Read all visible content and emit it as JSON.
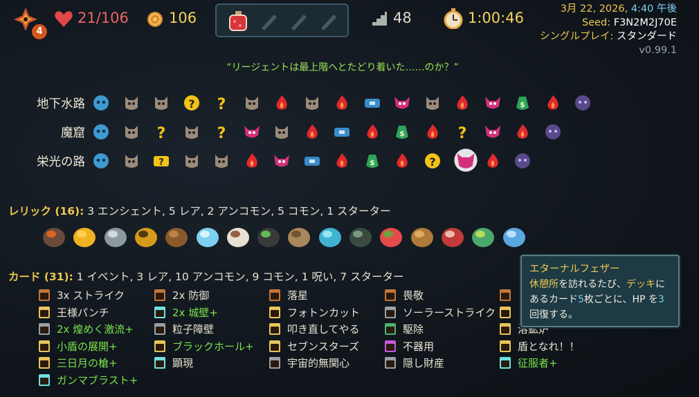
{
  "top_bar": {
    "floor_badge": "4",
    "hp": "21/106",
    "gold": "106",
    "floor": "48",
    "timer": "1:00:46",
    "potions": [
      "red-potion",
      "empty-slot",
      "empty-slot",
      "empty-slot"
    ]
  },
  "info": {
    "date": "3月 22, 2026, ",
    "time": "4:40 午後",
    "seed_label": "Seed: ",
    "seed": "F3N2M2J70E",
    "mode_label": "シングルプレイ: ",
    "mode": "スタンダード",
    "version": "v0.99.1"
  },
  "quote": "“リージェントは最上階へとたどり着いた……のか？”",
  "acts": [
    {
      "label": "地下水路",
      "nodes": [
        "ancient",
        "monster",
        "monster",
        "unknown-gold",
        "unknown",
        "monster",
        "rest",
        "monster",
        "rest",
        "treasure",
        "elite",
        "monster",
        "rest",
        "elite",
        "merchant",
        "rest",
        "boss"
      ]
    },
    {
      "label": "魔窟",
      "nodes": [
        "ancient",
        "monster",
        "unknown",
        "monster",
        "unknown",
        "elite",
        "monster",
        "rest",
        "treasure",
        "rest",
        "merchant",
        "rest",
        "unknown",
        "elite",
        "rest",
        "boss"
      ]
    },
    {
      "label": "栄光の路",
      "nodes": [
        "ancient",
        "monster",
        "unknown-chest",
        "monster",
        "monster",
        "rest",
        "elite",
        "treasure",
        "rest",
        "merchant",
        "rest",
        "unknown-gold",
        "boss-elite",
        "rest",
        "boss"
      ]
    }
  ],
  "relics": {
    "label": "レリック (16):",
    "summary": " 3 エンシェント, 5 レア, 2 アンコモン, 5 コモン, 1 スターター",
    "items": [
      "ember-rock-icon",
      "gold-orb-icon",
      "grey-stone-icon",
      "golden-bowl-icon",
      "wood-planks-icon",
      "ticket-icon",
      "cocoa-cup-icon",
      "bracelet-icon",
      "backpack-icon",
      "crystal-icon",
      "teapot-icon",
      "strawberry-icon",
      "idol-icon",
      "red-creature-icon",
      "serpent-icon",
      "feather-icon"
    ]
  },
  "cards": {
    "label": "カード (31):",
    "summary": " 1 イベント, 3 レア, 10 アンコモン, 9 コモン, 1 呪い, 7 スターター",
    "columns": [
      [
        {
          "name": "3x ストライク",
          "up": false,
          "color": "#c2763a"
        },
        {
          "name": "王様パンチ",
          "up": false,
          "color": "#e8c45a"
        },
        {
          "name": "2x 煌めく激流+",
          "up": true,
          "color": "#9aa0a4"
        },
        {
          "name": "小盾の展開+",
          "up": true,
          "color": "#e8c45a"
        },
        {
          "name": "三日月の槍+",
          "up": true,
          "color": "#e8c45a"
        },
        {
          "name": "ガンマブラスト+",
          "up": true,
          "color": "#6fe0e0"
        }
      ],
      [
        {
          "name": "2x 防御",
          "up": false,
          "color": "#c2763a"
        },
        {
          "name": "2x 城壁+",
          "up": true,
          "color": "#6fe0e0"
        },
        {
          "name": "粒子障壁",
          "up": false,
          "color": "#9aa0a4"
        },
        {
          "name": "ブラックホール+",
          "up": true,
          "color": "#e8c45a"
        },
        {
          "name": "顕現",
          "up": false,
          "color": "#6fe0e0"
        }
      ],
      [
        {
          "name": "落星",
          "up": false,
          "color": "#c2763a"
        },
        {
          "name": "フォトンカット",
          "up": false,
          "color": "#e8c45a"
        },
        {
          "name": "叩き直してやる",
          "up": false,
          "color": "#e8c45a"
        },
        {
          "name": "セブンスターズ",
          "up": false,
          "color": "#e8c45a"
        },
        {
          "name": "宇宙的無関心",
          "up": false,
          "color": "#9aa0a4"
        }
      ],
      [
        {
          "name": "畏敬",
          "up": false,
          "color": "#c2763a"
        },
        {
          "name": "ソーラーストライク",
          "up": false,
          "color": "#9aa0a4"
        },
        {
          "name": "駆除",
          "up": false,
          "color": "#4bb36e"
        },
        {
          "name": "不器用",
          "up": false,
          "color": "#c35ad8"
        },
        {
          "name": "隠し財産",
          "up": false,
          "color": "#9aa0a4"
        }
      ],
      [
        {
          "name": "",
          "up": false,
          "color": "#c2763a"
        },
        {
          "name": "",
          "up": false,
          "color": "#e8c45a"
        },
        {
          "name": "溶鉱炉",
          "up": false,
          "color": "#e8c45a"
        },
        {
          "name": "盾となれ！！",
          "up": false,
          "color": "#e8c45a"
        },
        {
          "name": "征服者+",
          "up": true,
          "color": "#6fe0e0"
        }
      ]
    ]
  },
  "tooltip": {
    "title": "エターナルフェザー",
    "kw1": "休憩所",
    "t1": "を訪れるたび、",
    "kw2": "デッキ",
    "t2": "にあるカード",
    "n1": "5",
    "t3": "枚ごとに、HP を",
    "n2": "3",
    "t4": "回復する。"
  }
}
